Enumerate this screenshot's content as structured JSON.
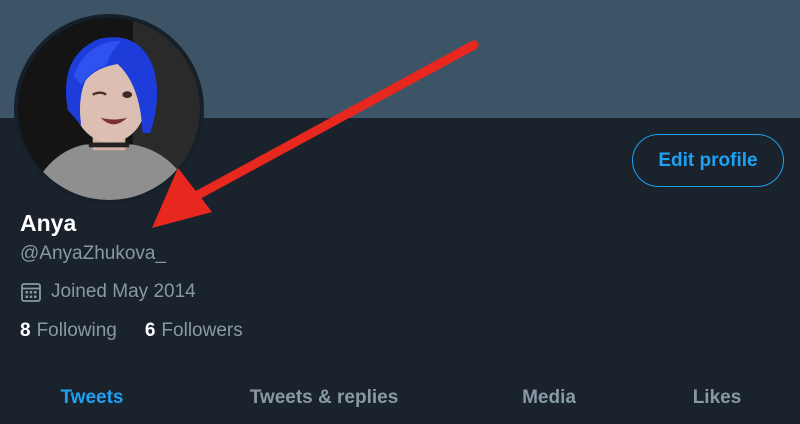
{
  "profile": {
    "display_name": "Anya",
    "handle": "@AnyaZhukova_",
    "joined": "Joined May 2014",
    "following_count": "8",
    "following_label": "Following",
    "followers_count": "6",
    "followers_label": "Followers"
  },
  "actions": {
    "edit_profile_label": "Edit profile"
  },
  "tabs": [
    {
      "label": "Tweets",
      "active": true
    },
    {
      "label": "Tweets & replies",
      "active": false
    },
    {
      "label": "Media",
      "active": false
    },
    {
      "label": "Likes",
      "active": false
    }
  ],
  "icons": {
    "joined": "calendar-icon"
  },
  "colors": {
    "banner": "#3d5466",
    "background": "#1a222c",
    "accent": "#1da1f2",
    "secondary_text": "#8899a6",
    "annotation_arrow": "#e8281e"
  }
}
